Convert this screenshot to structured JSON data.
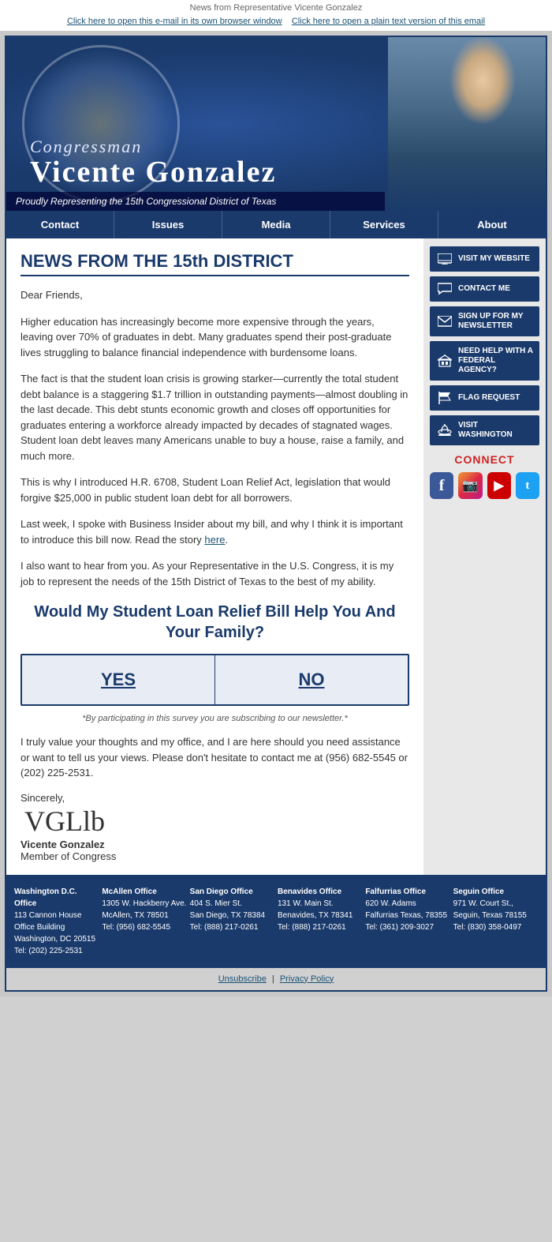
{
  "preheader": {
    "text": "News from Representative Vicente Gonzalez"
  },
  "toplinks": {
    "browser_link": "Click here to open this e-mail in its own browser window",
    "plain_link": "Click here to open a plain text version of this email"
  },
  "header": {
    "congressman_label": "Congressman",
    "name": "Vicente Gonzalez",
    "subtitle": "Proudly Representing the 15th Congressional District of Texas"
  },
  "nav": {
    "items": [
      "Contact",
      "Issues",
      "Media",
      "Services",
      "About"
    ]
  },
  "sidebar": {
    "buttons": [
      {
        "label": "VISIT MY WEBSITE",
        "icon": "monitor"
      },
      {
        "label": "CONTACT ME",
        "icon": "comment"
      },
      {
        "label": "SIGN UP FOR MY NEWSLETTER",
        "icon": "envelope"
      },
      {
        "label": "NEED HELP WITH A FEDERAL AGENCY?",
        "icon": "building"
      },
      {
        "label": "FLAG REQUEST",
        "icon": "flag"
      },
      {
        "label": "VISIT WASHINGTON",
        "icon": "dome"
      }
    ],
    "connect_label": "CONNECT",
    "social": [
      {
        "name": "facebook",
        "color": "#3b5998",
        "letter": "f"
      },
      {
        "name": "instagram",
        "color": "#c13584",
        "letter": "i"
      },
      {
        "name": "youtube",
        "color": "#cc0000",
        "letter": "▶"
      },
      {
        "name": "twitter",
        "color": "#1da1f2",
        "letter": "t"
      }
    ]
  },
  "content": {
    "news_title": "NEWS FROM THE 15th DISTRICT",
    "greeting": "Dear Friends,",
    "paragraphs": [
      "Higher education has increasingly become more expensive through the years, leaving over 70% of graduates in debt. Many graduates spend their post-graduate lives struggling to balance financial independence with burdensome loans.",
      "The fact is that the student loan crisis is growing starker—currently the total student debt balance is a staggering $1.7 trillion in outstanding payments—almost doubling in the last decade. This debt stunts economic growth and closes off opportunities for graduates entering a workforce already impacted by decades of stagnated wages. Student loan debt leaves many Americans unable to buy a house, raise a family, and much more.",
      "This is why I introduced H.R. 6708, Student Loan Relief Act, legislation that would forgive $25,000 in public student loan debt for all borrowers.",
      "Last week, I spoke with Business Insider about my bill, and why I think it is important to introduce this bill now. Read the story here.",
      "I also want to hear from you. As your Representative in the U.S. Congress, it is my job to represent the needs of the 15th District of Texas to the best of my ability."
    ],
    "here_link": "here",
    "survey_title": "Would My Student Loan Relief Bill Help You And Your Family?",
    "survey_yes": "YES",
    "survey_no": "NO",
    "survey_note": "*By participating in this survey you are subscribing to our newsletter.*",
    "closing": "I truly value your thoughts and my office, and I are here should you need assistance or want to tell us your views. Please don't hesitate to contact me at (956) 682-5545 or (202) 225-2531.",
    "sincerely": "Sincerely,",
    "signature_name": "Vicente Gonzalez",
    "signature_title": "Member of Congress"
  },
  "footer": {
    "offices": [
      {
        "name": "Washington D.C. Office",
        "address": "113 Cannon House Office Building",
        "city": "Washington, DC 20515",
        "tel": "Tel: (202) 225-2531"
      },
      {
        "name": "McAllen Office",
        "address": "1305 W. Hackberry Ave.",
        "city": "McAllen, TX 78501",
        "tel": "Tel: (956) 682-5545"
      },
      {
        "name": "San Diego Office",
        "address": "404 S. Mier St.",
        "city": "San Diego, TX 78384",
        "tel": "Tel: (888) 217-0261"
      },
      {
        "name": "Benavides Office",
        "address": "131 W. Main St.",
        "city": "Benavides, TX 78341",
        "tel": "Tel: (888) 217-0261"
      },
      {
        "name": "Falfurrias Office",
        "address": "620 W. Adams",
        "city": "Falfurrias Texas, 78355",
        "tel": "Tel: (361) 209-3027"
      },
      {
        "name": "Seguin Office",
        "address": "971 W. Court St., Seguin, Texas 78155",
        "city": "",
        "tel": "Tel: (830) 358-0497"
      }
    ],
    "unsubscribe": "Unsubscribe",
    "privacy": "Privacy Policy"
  }
}
